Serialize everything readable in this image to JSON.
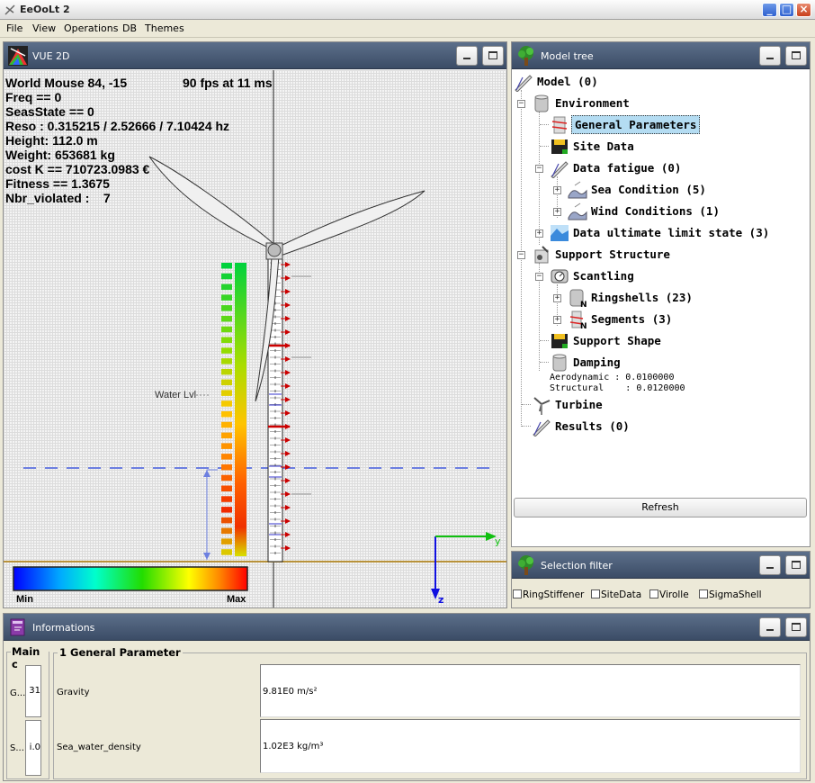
{
  "app": {
    "title": "EeOoLt 2"
  },
  "menu": {
    "file": "File",
    "view": "View",
    "operations": "Operations",
    "db": "DB",
    "themes": "Themes"
  },
  "view2d": {
    "title": "VUE 2D",
    "hud": {
      "mouse": "World Mouse 84, -15",
      "fps": "90 fps at 11 ms",
      "freq": "Freq == 0",
      "seastate": "SeasState == 0",
      "reso": "Reso : 0.315215 / 2.52666 / 7.10424 hz",
      "height": "Height: 112.0 m",
      "weight": "Weight: 653681 kg",
      "cost": "cost K == 710723.0983 €",
      "fitness": "Fitness == 1.3675",
      "violated": "Nbr_violated :    7"
    },
    "water_label": "Water Lvl",
    "legend_min": "Min",
    "legend_max": "Max",
    "axis_y": "y",
    "axis_z": "z",
    "colors": {
      "water": "#6c7fe0",
      "seabed": "#b8923a",
      "load_arrow": "#cc0000",
      "axis_y": "#10c010",
      "axis_z": "#1010e0"
    }
  },
  "tree": {
    "title": "Model tree",
    "items": [
      {
        "label": "Model (0)"
      },
      {
        "label": "Environment"
      },
      {
        "label": "General Parameters"
      },
      {
        "label": "Site Data"
      },
      {
        "label": "Data fatigue (0)"
      },
      {
        "label": "Sea Condition (5)"
      },
      {
        "label": "Wind Conditions (1)"
      },
      {
        "label": "Data ultimate limit state (3)"
      },
      {
        "label": "Support Structure"
      },
      {
        "label": "Scantling"
      },
      {
        "label": "Ringshells (23)"
      },
      {
        "label": "Segments (3)"
      },
      {
        "label": "Support Shape"
      },
      {
        "label": "Damping"
      },
      {
        "label": "Turbine"
      },
      {
        "label": "Results (0)"
      }
    ],
    "damping_notes": [
      "Aerodynamic : 0.0100000",
      "Structural    : 0.0120000"
    ],
    "refresh": "Refresh"
  },
  "filter": {
    "title": "Selection filter",
    "items": [
      "RingStiffener",
      "SiteData",
      "Virolle",
      "SigmaShell"
    ]
  },
  "info": {
    "title": "Informations",
    "main_group": "Main c",
    "main_rows": [
      {
        "label": "G...",
        "value": "31"
      },
      {
        "label": "S...",
        "value": "i.0"
      }
    ],
    "param_group": "1 General Parameter",
    "params": [
      {
        "name": "Gravity",
        "value": "9.81E0 m/s²"
      },
      {
        "name": "Sea_water_density",
        "value": "1.02E3 kg/m³"
      }
    ]
  }
}
